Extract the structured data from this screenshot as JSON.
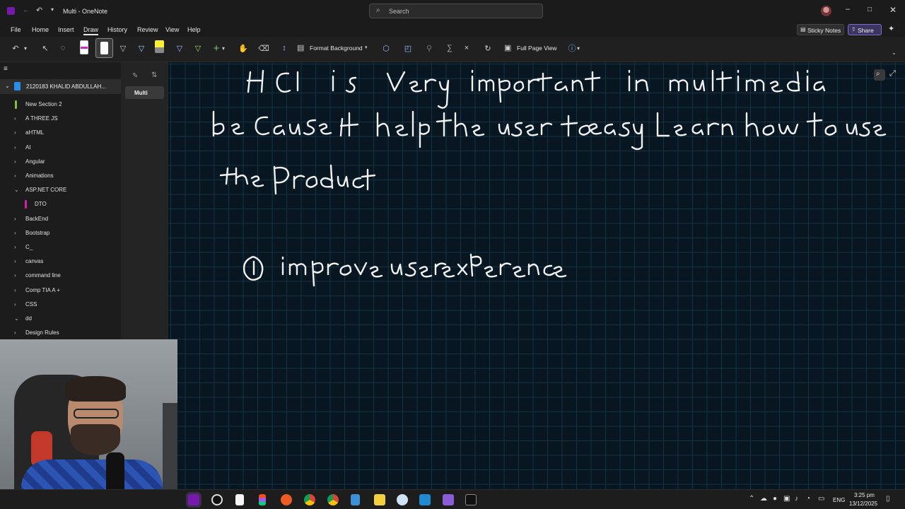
{
  "window": {
    "app_title": "Multi - OneNote",
    "search_placeholder": "Search"
  },
  "menu": {
    "items": [
      "File",
      "Home",
      "Insert",
      "Draw",
      "History",
      "Review",
      "View",
      "Help"
    ],
    "active": "Draw"
  },
  "header_right": {
    "sticky_notes": "Sticky Notes",
    "share": "Share"
  },
  "ribbon": {
    "format_background": "Format Background",
    "full_page_view": "Full Page View"
  },
  "notebook": {
    "name": "2120183 KHALID ABDULLAH..."
  },
  "sections": [
    {
      "label": "New Section 2",
      "color": "#7ec241"
    },
    {
      "label": "A THREE JS"
    },
    {
      "label": "aHTML"
    },
    {
      "label": "AI"
    },
    {
      "label": "Angular"
    },
    {
      "label": "Animations"
    },
    {
      "label": "ASP.NET CORE"
    },
    {
      "label": "DTO",
      "color": "#d61fa8"
    },
    {
      "label": "BackEnd"
    },
    {
      "label": "Bootstrap"
    },
    {
      "label": "C_"
    },
    {
      "label": "canvas"
    },
    {
      "label": "command line"
    },
    {
      "label": "Comp TIA A +"
    },
    {
      "label": "CSS"
    },
    {
      "label": "dd"
    },
    {
      "label": "Design Rules"
    }
  ],
  "pages": {
    "current": "Multi"
  },
  "ink_text": {
    "line1": "HCI is very important in multimedia",
    "line2": "because it help the user to easy learn how to use",
    "line3": "the Product",
    "item1": "1) improve user exPerence"
  },
  "clock": {
    "time": "3:25 pm",
    "date": "13/12/2025",
    "lang": "ENG"
  },
  "colors": {
    "canvas_bg": "#071620",
    "grid": "#173243",
    "accent": "#7e6bd6"
  }
}
